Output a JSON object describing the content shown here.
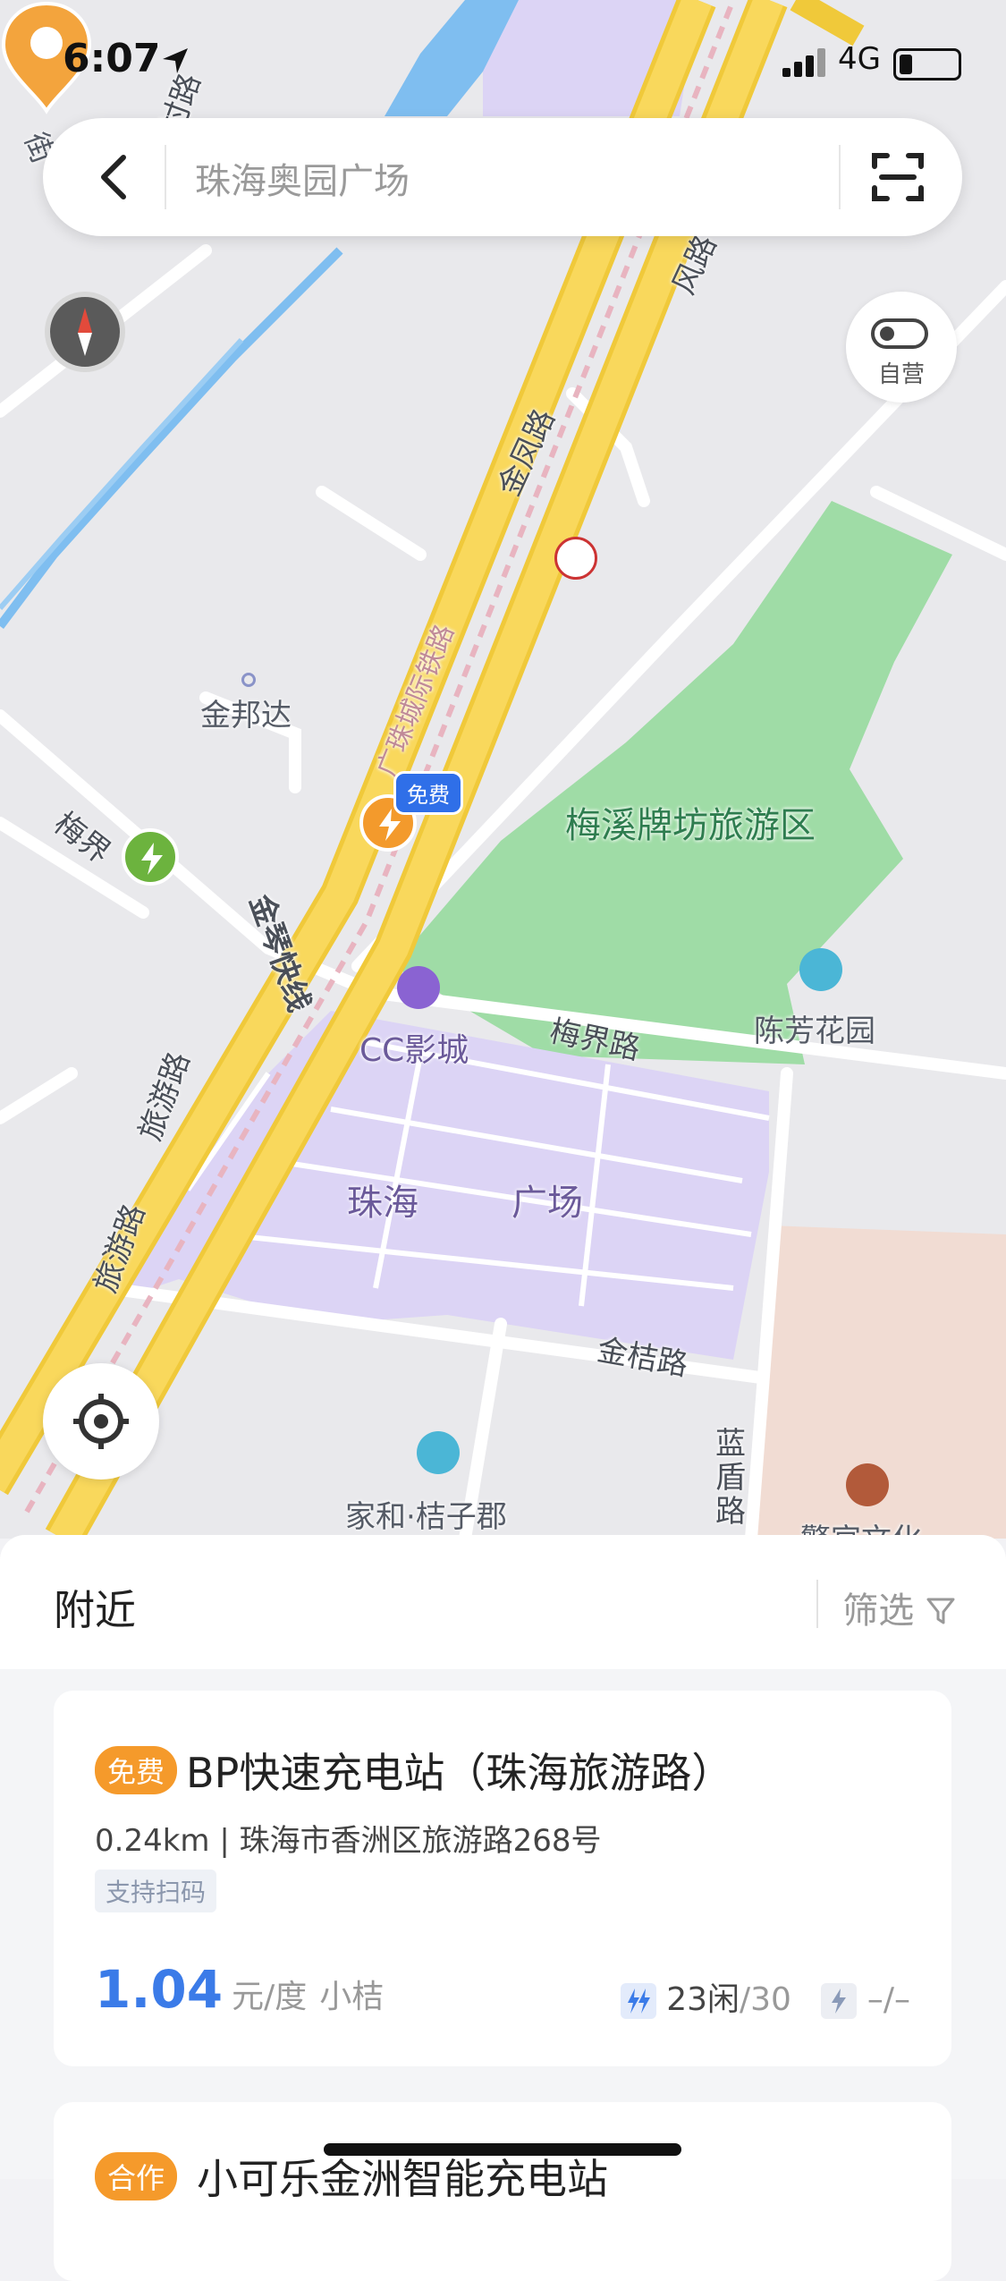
{
  "status_bar": {
    "time": "6:07",
    "network": "4G"
  },
  "search": {
    "placeholder": "珠海奥园广场"
  },
  "map": {
    "toggle_label": "自营",
    "free_tag": "免费",
    "labels": {
      "jinbangda": "金邦达",
      "meixi": "梅溪牌坊旅游区",
      "chenfang": "陈芳花园",
      "cc_cinema": "CC影城",
      "meijie_road": "梅界路",
      "meijie_road_left": "梅界",
      "plaza_left": "珠海",
      "plaza_right": "广场",
      "jinju_road": "金桔路",
      "jiahe": "家和·桔子郡",
      "lanqiao_road": "蓝盾路",
      "jinfeng_road": "金凤路",
      "jinfeng_road_top": "风路",
      "railway": "广珠城际铁路",
      "expressway": "金琴快线",
      "lvyou_road_1": "旅游路",
      "lvyou_road_2": "旅游路",
      "village_road": "村路",
      "street": "街",
      "museum": "警官文化"
    },
    "colors": {
      "park": "#9fdca6",
      "plaza": "#dcd4f5",
      "highway": "#f7d24a",
      "water": "#7fbef0",
      "orange_pin": "#f39a2c"
    }
  },
  "sheet": {
    "title": "附近",
    "filter_label": "筛选",
    "cards": [
      {
        "badge": "免费",
        "name": "BP快速充电站（珠海旅游路）",
        "address": "0.24km | 珠海市香洲区旅游路268号",
        "tag": "支持扫码",
        "price": "1.04",
        "unit": "元/度",
        "brand": "小桔",
        "fast_free": "23闲",
        "fast_total": "/30",
        "slow": "–/–"
      },
      {
        "badge": "合作",
        "name": "小可乐金洲智能充电站"
      }
    ]
  }
}
